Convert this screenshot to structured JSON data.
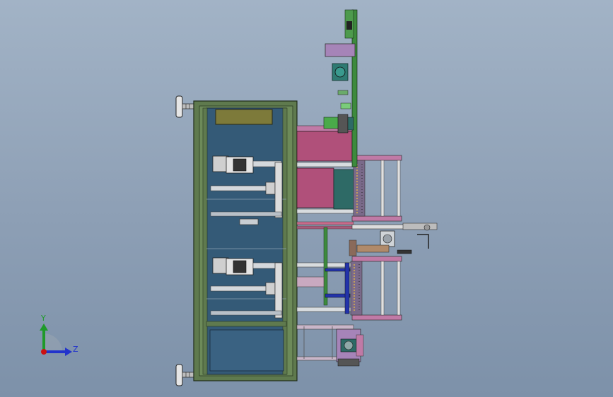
{
  "triad": {
    "y_label": "Y",
    "z_label": "Z",
    "y_color": "#1f9a2a",
    "z_color": "#2233cc",
    "x_color": "#cc1111"
  },
  "palette": {
    "frame_green": "#5f7a4e",
    "panel_blue": "#345a77",
    "olive_plate": "#7d7a3a",
    "magenta_block": "#b0507a",
    "pink_frame": "#c07aa6",
    "teal_block": "#2e6a66",
    "green_rail": "#3d8a3d",
    "lilac_box": "#a684b8",
    "steel": "#d4d8dc",
    "dark": "#2a2a2a"
  }
}
